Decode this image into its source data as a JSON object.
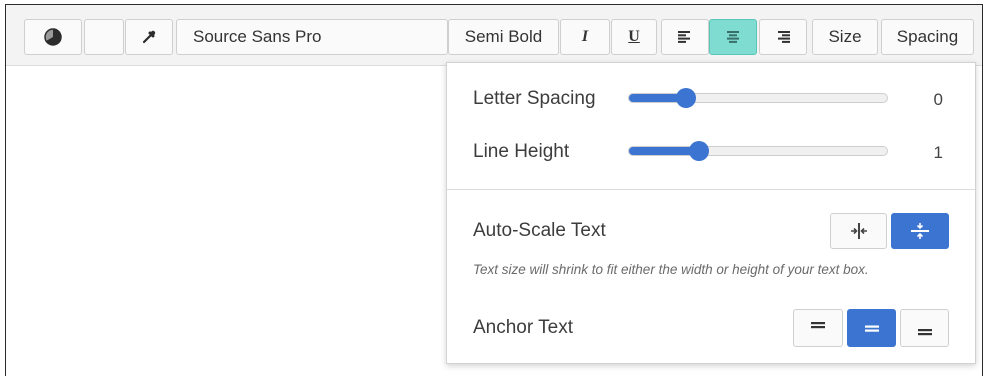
{
  "toolbar": {
    "font_family": "Source Sans Pro",
    "font_weight": "Semi Bold",
    "italic_label": "I",
    "underline_label": "U",
    "size_label": "Size",
    "spacing_label": "Spacing",
    "active_alignment": "center"
  },
  "spacing_panel": {
    "letter_spacing": {
      "label": "Letter Spacing",
      "value": "0",
      "fill_fraction": 0.22
    },
    "line_height": {
      "label": "Line Height",
      "value": "1",
      "fill_fraction": 0.27
    },
    "auto_scale": {
      "label": "Auto-Scale Text",
      "hint": "Text size will shrink to fit either the width or height of your text box.",
      "selected": "height"
    },
    "anchor": {
      "label": "Anchor Text",
      "selected": "middle"
    }
  },
  "colors": {
    "accent": "#3b74d1",
    "active_align": "#7fdcd0"
  }
}
